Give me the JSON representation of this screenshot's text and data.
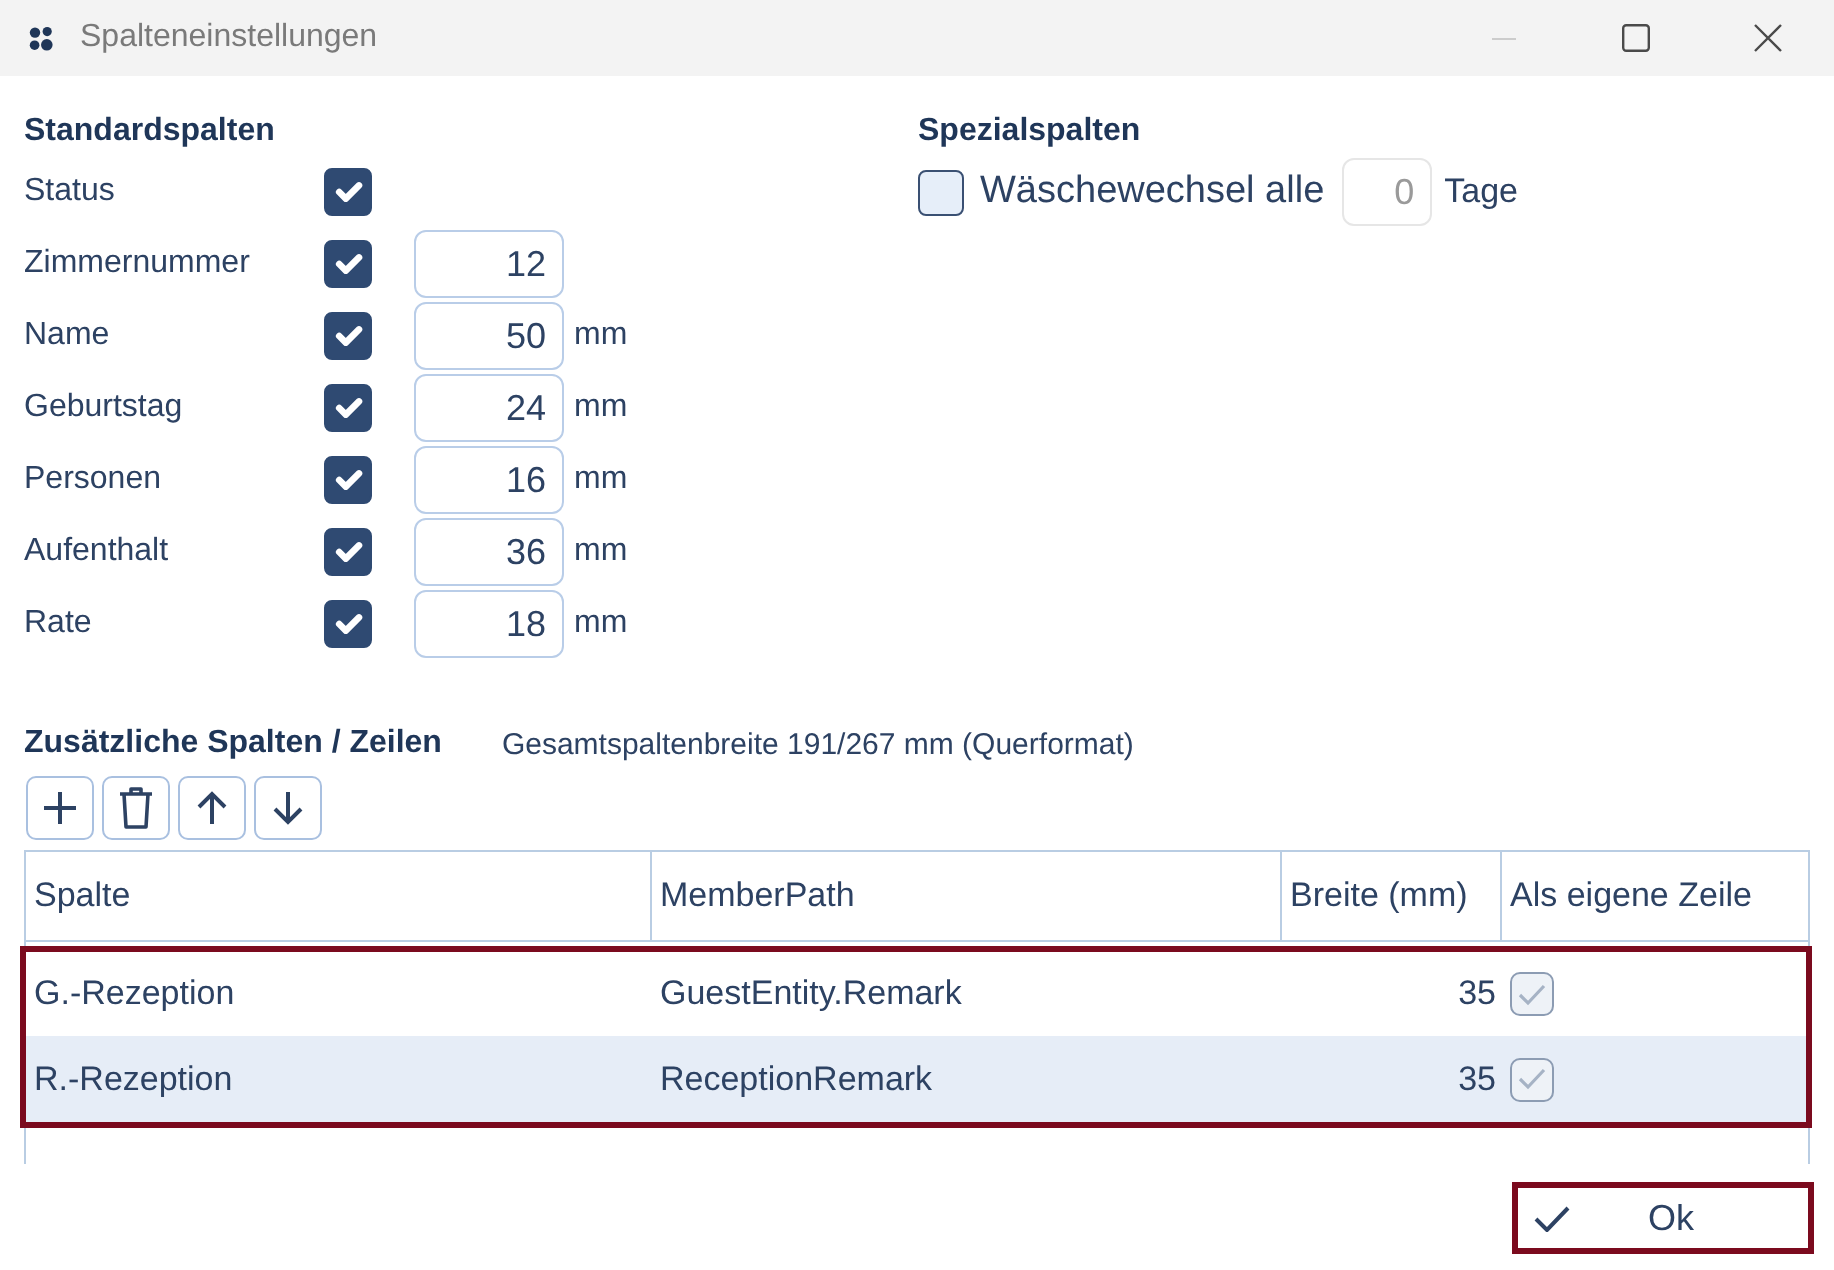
{
  "window": {
    "title": "Spalteneinstellungen",
    "controls": [
      {
        "kind": "minimize",
        "disabled": true
      },
      {
        "kind": "maximize",
        "disabled": false
      },
      {
        "kind": "close",
        "disabled": false
      }
    ]
  },
  "standard_columns": {
    "title": "Standardspalten",
    "items": [
      {
        "label": "Status",
        "checked": true
      },
      {
        "label": "Zimmernummer",
        "checked": true,
        "value": "12"
      },
      {
        "label": "Name",
        "checked": true,
        "value": "50",
        "unit": "mm"
      },
      {
        "label": "Geburtstag",
        "checked": true,
        "value": "24",
        "unit": "mm"
      },
      {
        "label": "Personen",
        "checked": true,
        "value": "16",
        "unit": "mm"
      },
      {
        "label": "Aufenthalt",
        "checked": true,
        "value": "36",
        "unit": "mm"
      },
      {
        "label": "Rate",
        "checked": true,
        "value": "18",
        "unit": "mm"
      }
    ]
  },
  "special_columns": {
    "title": "Spezialspalten",
    "laundry": {
      "label": "Wäschewechsel alle",
      "checked": false,
      "value": "0",
      "disabled": true,
      "unit": "Tage"
    }
  },
  "additional": {
    "title": "Zusätzliche Spalten / Zeilen",
    "summary": "Gesamtspaltenbreite 191/267 mm (Querformat)",
    "toolbar": [
      {
        "kind": "add"
      },
      {
        "kind": "delete"
      },
      {
        "kind": "up"
      },
      {
        "kind": "down"
      }
    ],
    "table": {
      "columns": [
        "Spalte",
        "MemberPath",
        "Breite (mm)",
        "Als eigene Zeile"
      ],
      "outlined": true,
      "rows": [
        {
          "cells": [
            "G.-Rezeption",
            "GuestEntity.Remark",
            "35"
          ],
          "own_row": true,
          "selected": false
        },
        {
          "cells": [
            "R.-Rezeption",
            "ReceptionRemark",
            "35"
          ],
          "own_row": true,
          "selected": true
        }
      ]
    }
  },
  "ok_button": {
    "label": "Ok",
    "outlined": true
  }
}
